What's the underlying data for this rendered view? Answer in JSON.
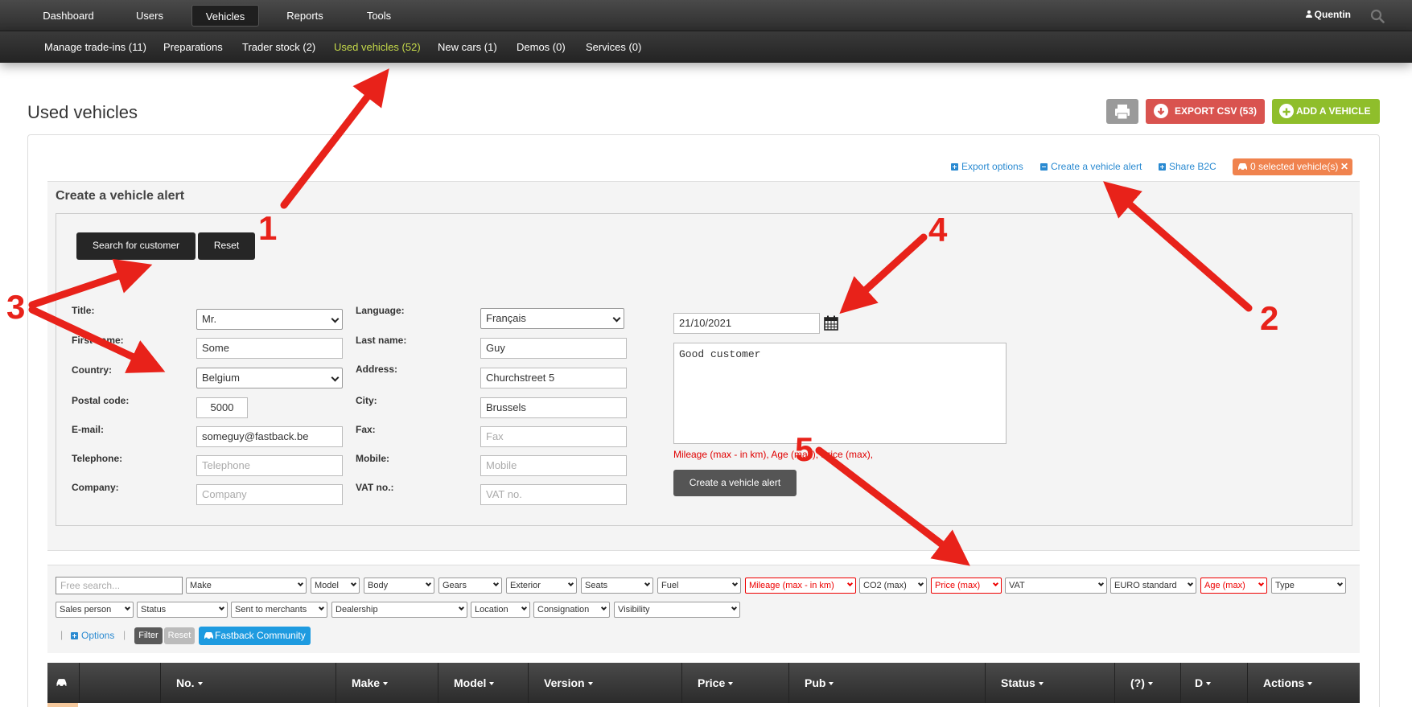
{
  "topnav": {
    "items": [
      "Dashboard",
      "Users",
      "Vehicles",
      "Reports",
      "Tools"
    ],
    "active": "Vehicles",
    "user": "Quentin"
  },
  "subnav": {
    "items": [
      "Manage trade-ins (11)",
      "Preparations",
      "Trader stock (2)",
      "Used vehicles (52)",
      "New cars (1)",
      "Demos (0)",
      "Services (0)"
    ],
    "active": "Used vehicles (52)"
  },
  "page": {
    "title": "Used vehicles",
    "export_label": "EXPORT CSV (53)",
    "add_label": "ADD A VEHICLE"
  },
  "links": {
    "export_options": "Export options",
    "create_alert": "Create a vehicle alert",
    "share_b2c": "Share B2C",
    "selected": "0 selected vehicle(s)"
  },
  "alert_form": {
    "title": "Create a vehicle alert",
    "search_customer": "Search for customer",
    "reset": "Reset",
    "labels": {
      "title": "Title:",
      "first_name": "First name:",
      "country": "Country:",
      "postal_code": "Postal code:",
      "email": "E-mail:",
      "telephone": "Telephone:",
      "company": "Company:",
      "language": "Language:",
      "last_name": "Last name:",
      "address": "Address:",
      "city": "City:",
      "fax": "Fax:",
      "mobile": "Mobile:",
      "vat": "VAT no.:"
    },
    "values": {
      "title": "Mr.",
      "first_name": "Some",
      "country": "Belgium",
      "postal_code": "5000",
      "email": "someguy@fastback.be",
      "language": "Français",
      "last_name": "Guy",
      "address": "Churchstreet 5",
      "city": "Brussels",
      "date": "21/10/2021",
      "notes": "Good customer"
    },
    "placeholders": {
      "telephone": "Telephone",
      "company": "Company",
      "fax": "Fax",
      "mobile": "Mobile",
      "vat": "VAT no."
    },
    "warning": "Mileage (max - in km), Age (max), Price (max),",
    "submit": "Create a vehicle alert"
  },
  "filters": {
    "free_search_placeholder": "Free search...",
    "row1": [
      "Make",
      "Model",
      "Body",
      "Gears",
      "Exterior",
      "Seats",
      "Fuel",
      "Mileage (max - in km)",
      "CO2 (max)",
      "Price (max)",
      "VAT",
      "EURO standard",
      "Age (max)",
      "Type"
    ],
    "row2": [
      "Sales person",
      "Status",
      "Sent to merchants",
      "Dealership",
      "Location",
      "Consignation",
      "Visibility"
    ],
    "options": "Options",
    "filter": "Filter",
    "reset": "Reset",
    "community": "Fastback Community"
  },
  "table": {
    "columns": [
      "No.",
      "Make",
      "Model",
      "Version",
      "Price",
      "Pub",
      "Status",
      "(?)",
      "D",
      "Actions"
    ]
  },
  "annotations": [
    "1",
    "2",
    "3",
    "4",
    "5"
  ],
  "colors": {
    "accent_link": "#2a8ad1",
    "export": "#d9534f",
    "add": "#8fbe2b",
    "selected_badge": "#f0834e",
    "active_subnav": "#c5d94a",
    "annotation": "#e8221a"
  }
}
